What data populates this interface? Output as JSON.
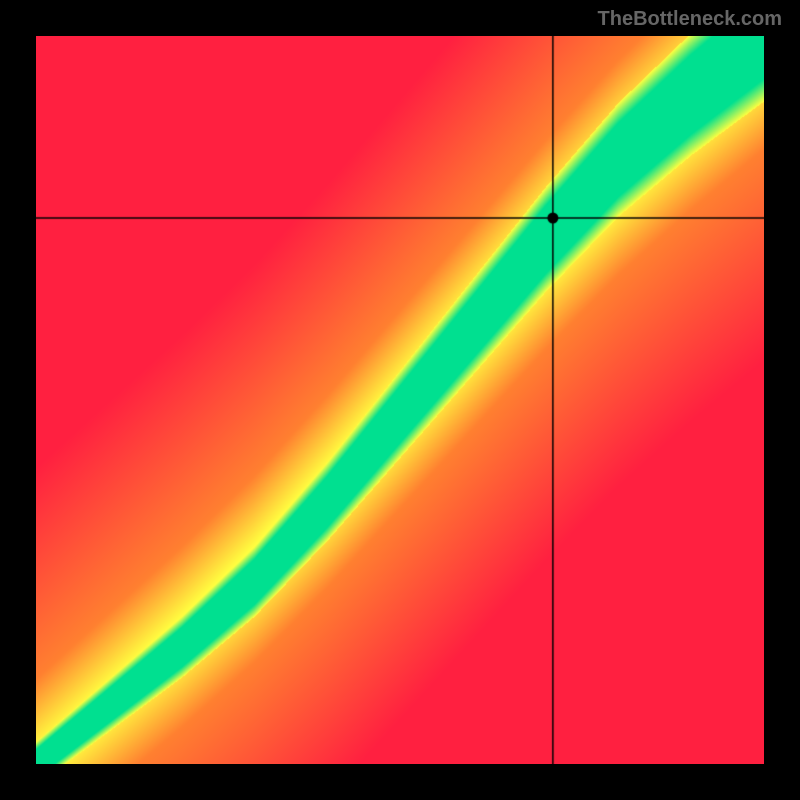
{
  "watermark": "TheBottleneck.com",
  "chart_data": {
    "type": "heatmap",
    "title": "",
    "xlabel": "",
    "ylabel": "",
    "xlim": [
      0,
      100
    ],
    "ylim": [
      0,
      100
    ],
    "marker": {
      "x": 71,
      "y": 75
    },
    "crosshair": {
      "x": 71,
      "y": 75
    },
    "optimal_curve_points": [
      {
        "x": 0,
        "y": 0
      },
      {
        "x": 10,
        "y": 8
      },
      {
        "x": 20,
        "y": 16
      },
      {
        "x": 30,
        "y": 25
      },
      {
        "x": 40,
        "y": 36
      },
      {
        "x": 50,
        "y": 48
      },
      {
        "x": 60,
        "y": 60
      },
      {
        "x": 70,
        "y": 72
      },
      {
        "x": 80,
        "y": 83
      },
      {
        "x": 90,
        "y": 92
      },
      {
        "x": 100,
        "y": 100
      }
    ],
    "color_stops": {
      "optimal": "#00e090",
      "good": "#ffff40",
      "poor": "#ff8030",
      "bad": "#ff2040"
    },
    "description": "Bottleneck heatmap: green diagonal band indicates balanced performance; red regions indicate severe bottleneck. Marker shows selected configuration near optimal zone."
  }
}
